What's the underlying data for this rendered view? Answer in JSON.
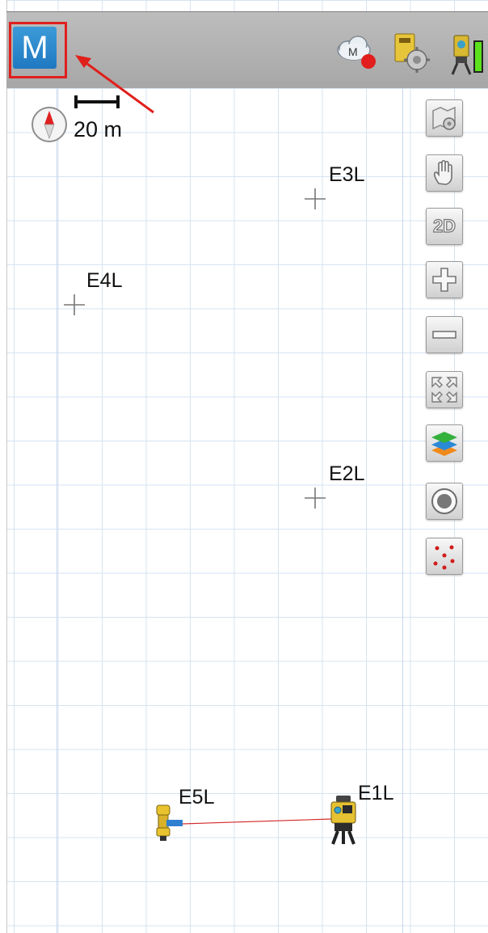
{
  "header": {
    "app_logo_letter": "M",
    "cloud_badge_letter": "M"
  },
  "map": {
    "scale_label": "20 m",
    "points": [
      {
        "id": "e3l",
        "label": "E3L"
      },
      {
        "id": "e4l",
        "label": "E4L"
      },
      {
        "id": "e2l",
        "label": "E2L"
      },
      {
        "id": "e5l",
        "label": "E5L"
      },
      {
        "id": "e1l",
        "label": "E1L"
      }
    ]
  },
  "toolbar": {
    "view_mode_label": "2D",
    "items": [
      "map-settings",
      "pan",
      "2d-view",
      "zoom-in",
      "zoom-out",
      "zoom-extents",
      "layers",
      "record",
      "points-display"
    ]
  },
  "colors": {
    "highlight": "#e0201c",
    "logo_blue": "#1f78c1",
    "grid": "#d6e3f3",
    "measure_line": "#d42a2a"
  }
}
